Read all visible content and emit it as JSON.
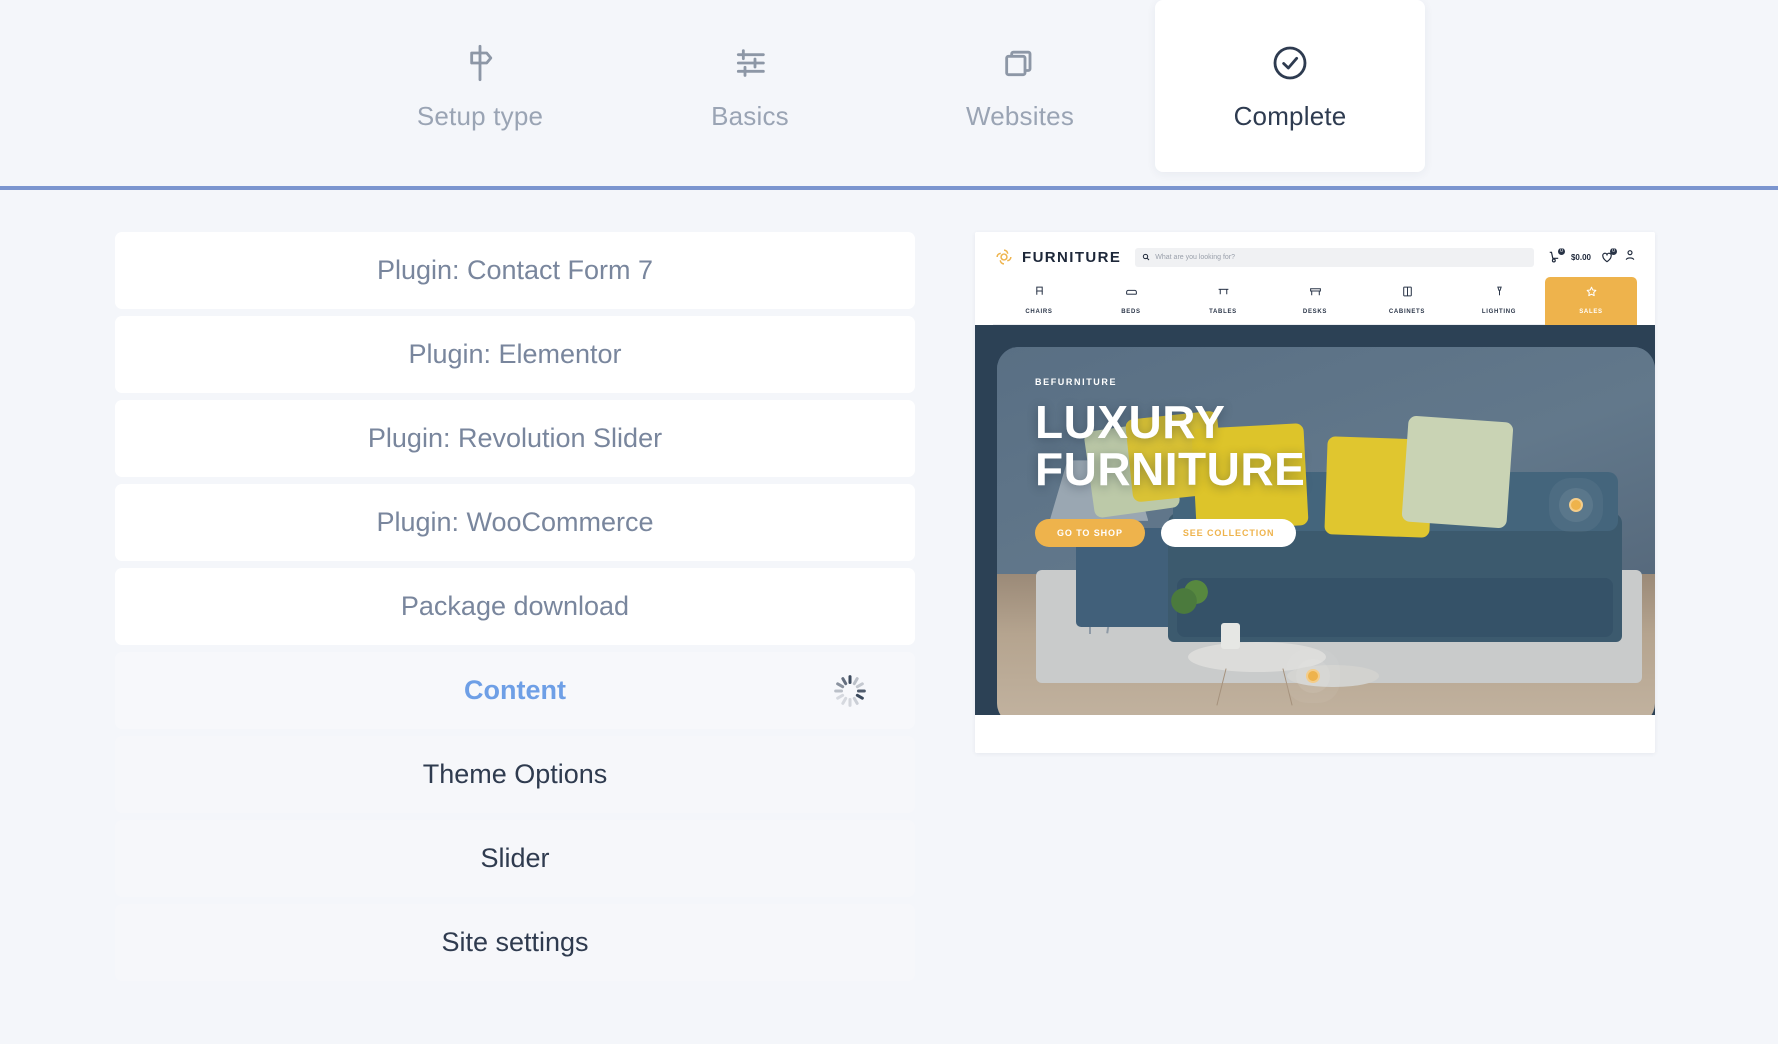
{
  "wizard": {
    "steps": [
      {
        "label": "Setup type",
        "icon": "signpost-icon",
        "active": false
      },
      {
        "label": "Basics",
        "icon": "sliders-icon",
        "active": false
      },
      {
        "label": "Websites",
        "icon": "layers-icon",
        "active": false
      },
      {
        "label": "Complete",
        "icon": "check-circle-icon",
        "active": true
      }
    ],
    "accent_color": "#7b95cf"
  },
  "tasks": {
    "items": [
      {
        "label": "Plugin: Contact Form 7",
        "state": "done"
      },
      {
        "label": "Plugin: Elementor",
        "state": "done"
      },
      {
        "label": "Plugin: Revolution Slider",
        "state": "done"
      },
      {
        "label": "Plugin: WooCommerce",
        "state": "done"
      },
      {
        "label": "Package download",
        "state": "done"
      },
      {
        "label": "Content",
        "state": "active"
      },
      {
        "label": "Theme Options",
        "state": "pending"
      },
      {
        "label": "Slider",
        "state": "pending"
      },
      {
        "label": "Site settings",
        "state": "pending"
      }
    ],
    "active_color": "#6e9fe6",
    "done_color": "#79869d",
    "pending_color": "#2f3b4f",
    "spinner_icon": "loading-spinner-icon"
  },
  "preview": {
    "brand": "FURNITURE",
    "logo_icon": "flower-logo-icon",
    "search": {
      "placeholder": "What are you looking for?",
      "icon": "search-icon"
    },
    "actions": {
      "cart_icon": "cart-icon",
      "cart_badge": "0",
      "price": "$0.00",
      "wishlist_icon": "heart-icon",
      "wishlist_badge": "0",
      "account_icon": "user-icon"
    },
    "nav": [
      {
        "label": "CHAIRS",
        "icon": "chair-icon",
        "highlight": false
      },
      {
        "label": "BEDS",
        "icon": "bed-icon",
        "highlight": false
      },
      {
        "label": "TABLES",
        "icon": "table-icon",
        "highlight": false
      },
      {
        "label": "DESKS",
        "icon": "desk-icon",
        "highlight": false
      },
      {
        "label": "CABINETS",
        "icon": "cabinet-icon",
        "highlight": false
      },
      {
        "label": "LIGHTING",
        "icon": "lamp-icon",
        "highlight": false
      },
      {
        "label": "SALES",
        "icon": "star-icon",
        "highlight": true
      }
    ],
    "hero": {
      "eyebrow": "BEFURNITURE",
      "title_line1": "LUXURY",
      "title_line2": "FURNITURE",
      "primary_button": "GO TO SHOP",
      "secondary_button": "SEE COLLECTION",
      "accent_color": "#eeb34c",
      "background_color": "#2c4155"
    }
  }
}
